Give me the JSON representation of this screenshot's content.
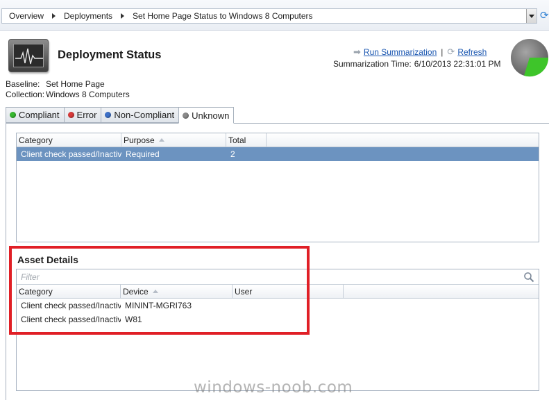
{
  "breadcrumb": [
    "Overview",
    "Deployments",
    "Set Home Page Status to Windows 8 Computers"
  ],
  "header": {
    "title": "Deployment Status",
    "run_summarization": "Run Summarization",
    "separator": "|",
    "refresh": "Refresh",
    "summarization_label": "Summarization Time:",
    "summarization_time": "6/10/2013 22:31:01 PM"
  },
  "meta": {
    "baseline_label": "Baseline:",
    "baseline_value": "Set Home Page",
    "collection_label": "Collection:",
    "collection_value": "Windows 8 Computers"
  },
  "tabs": [
    {
      "label": "Compliant",
      "color": "#36b82f"
    },
    {
      "label": "Error",
      "color": "#d93a3a"
    },
    {
      "label": "Non-Compliant",
      "color": "#3d71c9"
    },
    {
      "label": "Unknown",
      "color": "#8c8c8c"
    }
  ],
  "active_tab": "Unknown",
  "summary_table": {
    "columns": [
      "Category",
      "Purpose",
      "Total"
    ],
    "rows": [
      {
        "category": "Client check passed/Inactive",
        "purpose": "Required",
        "total": "2"
      }
    ]
  },
  "asset_details": {
    "title": "Asset Details",
    "filter_placeholder": "Filter",
    "columns": [
      "Category",
      "Device",
      "User"
    ],
    "rows": [
      {
        "category": "Client check passed/Inactive",
        "device": "MININT-MGRI763",
        "user": ""
      },
      {
        "category": "Client check passed/Inactive",
        "device": "W81",
        "user": ""
      }
    ]
  },
  "pie_colors": {
    "main": "#7f7f7f",
    "slice": "#3ec52a"
  },
  "watermark": "windows-noob.com"
}
